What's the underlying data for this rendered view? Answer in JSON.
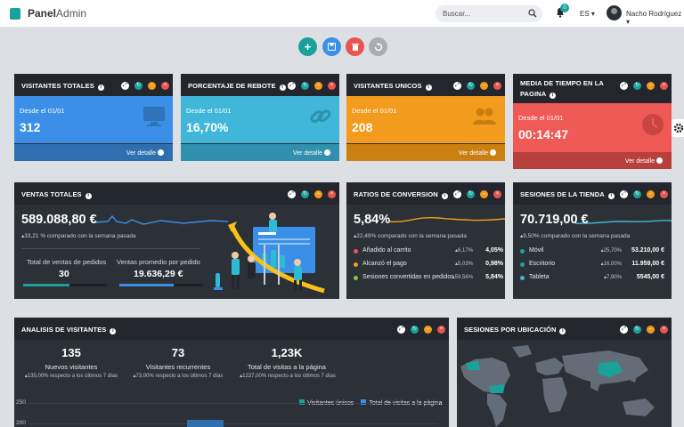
{
  "header": {
    "brand_bold": "Panel",
    "brand_light": "Admin",
    "search_placeholder": "Buscar...",
    "notification_count": "0",
    "language": "ES",
    "user_name": "Nacho Rodríguez"
  },
  "actions": [
    {
      "name": "add",
      "icon": "plus-icon",
      "color": "#1aa29a"
    },
    {
      "name": "save",
      "icon": "save-icon",
      "color": "#3b8fe6"
    },
    {
      "name": "delete",
      "icon": "trash-icon",
      "color": "#e8554e"
    },
    {
      "name": "reset",
      "icon": "undo-icon",
      "color": "#a9adb2"
    }
  ],
  "stat_cards": [
    {
      "title": "VISITANTES TOTALES",
      "since": "Desde el 01/01",
      "value": "312",
      "footer": "Ver detalle",
      "icon": "monitor-icon",
      "color": "#3b8fe6"
    },
    {
      "title": "PORCENTAJE DE REBOTE",
      "since": "Desde el 01/01",
      "value": "16,70%",
      "footer": "Ver detalle",
      "icon": "link-icon",
      "color": "#40b6d8"
    },
    {
      "title": "VISITANTES UNICOS",
      "since": "Desde el 01/01",
      "value": "208",
      "footer": "Ver detalle",
      "icon": "users-icon",
      "color": "#f29b1c"
    },
    {
      "title": "MEDIA DE TIEMPO EN LA PAGINA",
      "since": "Desde el 01/01",
      "value": "00:14:47",
      "footer": "Ver detalle",
      "icon": "clock-icon",
      "color": "#f05a56"
    }
  ],
  "ventas": {
    "title": "VENTAS TOTALES",
    "value": "589.088,80 €",
    "compare": "33,21 % comparado con la semana pasada",
    "total_label": "Total de ventas de pedidos",
    "total_value": "30",
    "avg_label": "Ventas promedio por pedido",
    "avg_value": "19.636,29 €"
  },
  "ratios": {
    "title": "RATIOS DE CONVERSION",
    "value": "5,84%",
    "compare": "22,49% comparado con la semana pasada",
    "rows": [
      {
        "label": "Añadido al carrito",
        "pct": "6,17%",
        "value": "4,05%",
        "color": "#e8554e"
      },
      {
        "label": "Alcanzó el pago",
        "pct": "5,03%",
        "value": "0,98%",
        "color": "#f29b1c"
      },
      {
        "label": "Sesiones convertidas en pedidos",
        "pct": "59,56%",
        "value": "5,84%",
        "color": "#8ac43f"
      }
    ]
  },
  "sesiones": {
    "title": "SESIONES DE LA TIENDA",
    "value": "70.719,00 €",
    "compare": "9,50% comparado con la semana pasada",
    "rows": [
      {
        "label": "Móvil",
        "pct": "25,70%",
        "value": "53.210,00 €",
        "color": "#1aa29a"
      },
      {
        "label": "Escritorio",
        "pct": "16,00%",
        "value": "11.959,00 €",
        "color": "#1aa29a"
      },
      {
        "label": "Tableta",
        "pct": "7,90%",
        "value": "5545,00 €",
        "color": "#40b6d8"
      }
    ]
  },
  "analisis": {
    "title": "ANALISIS DE VISITANTES",
    "stats": [
      {
        "value": "135",
        "label": "Nuevos visitantes",
        "sub": "135,00% respecto a los últimos 7 días"
      },
      {
        "value": "73",
        "label": "Visitantes recurrentes",
        "sub": "73,00% respecto a los últimos 7 días"
      },
      {
        "value": "1,23K",
        "label": "Total de visitas a la página",
        "sub": "1227,00% respecto a los últimos 7 días"
      }
    ],
    "legend": [
      "Visitantes únicos",
      "Total de visitas a la página"
    ],
    "y_ticks": [
      "250",
      "200"
    ]
  },
  "ubicacion": {
    "title": "SESIONES POR UBICACIÓN"
  }
}
